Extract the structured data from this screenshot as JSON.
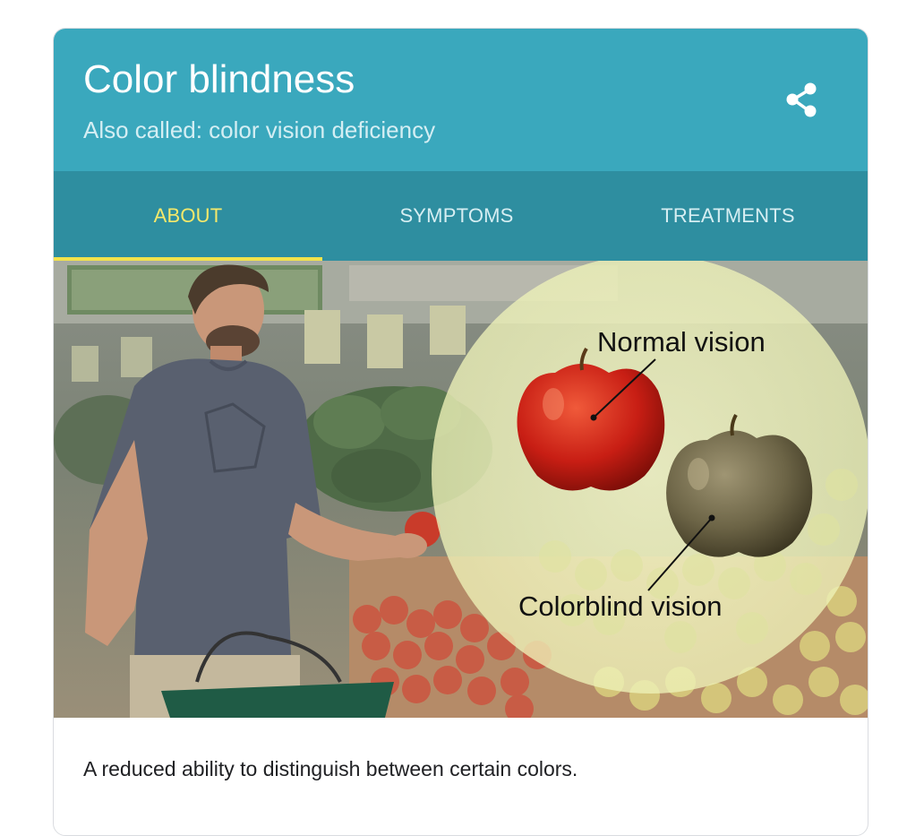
{
  "header": {
    "title": "Color blindness",
    "subtitle": "Also called: color vision deficiency",
    "share_icon": "share-icon",
    "background_color": "#3aa8bd"
  },
  "tabs": [
    {
      "label": "ABOUT",
      "active": true
    },
    {
      "label": "SYMPTOMS",
      "active": false
    },
    {
      "label": "TREATMENTS",
      "active": false
    }
  ],
  "tab_colors": {
    "bar": "#2e8ea0",
    "active_text": "#f6e96a",
    "indicator": "#f3e34b"
  },
  "image": {
    "normal_label": "Normal vision",
    "colorblind_label": "Colorblind vision"
  },
  "description": "A reduced ability to distinguish between certain colors."
}
